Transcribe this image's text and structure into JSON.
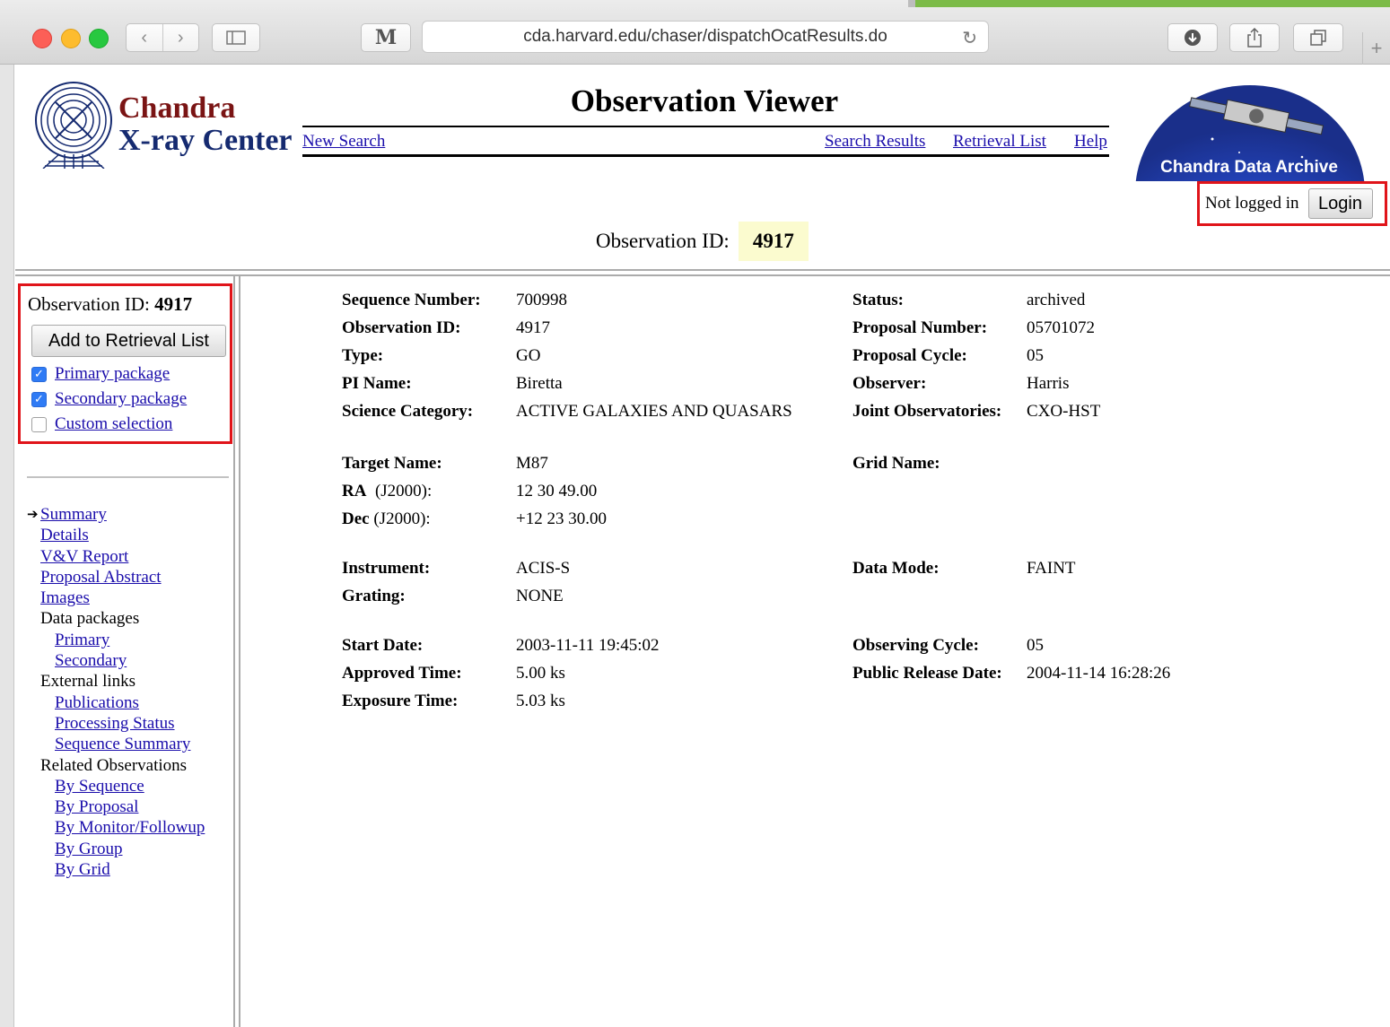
{
  "browser": {
    "url": "cda.harvard.edu/chaser/dispatchOcatResults.do",
    "reader_label": "M"
  },
  "header": {
    "logo_line1": "Chandra",
    "logo_line2": "X-ray Center",
    "title": "Observation Viewer",
    "nav": {
      "new_search": "New Search",
      "search_results": "Search Results",
      "retrieval_list": "Retrieval List",
      "help": "Help"
    },
    "archive_banner": "Chandra Data Archive",
    "login_status": "Not logged in",
    "login_button": "Login",
    "obsid_label": "Observation ID:",
    "obsid_value": "4917"
  },
  "sidebar": {
    "obsid_label": "Observation ID:",
    "obsid_value": "4917",
    "add_button": "Add to Retrieval List",
    "packages": [
      {
        "label": "Primary package",
        "checked": true
      },
      {
        "label": "Secondary package",
        "checked": true
      },
      {
        "label": "Custom selection",
        "checked": false
      }
    ],
    "nav": {
      "summary": "Summary",
      "details": "Details",
      "vv_report": "V&V Report",
      "proposal_abstract": "Proposal Abstract",
      "images": "Images",
      "data_packages": "Data packages",
      "primary": "Primary",
      "secondary": "Secondary",
      "external_links": "External links",
      "publications": "Publications",
      "processing_status": "Processing Status",
      "sequence_summary": "Sequence Summary",
      "related_observations": "Related Observations",
      "by_sequence": "By Sequence",
      "by_proposal": "By Proposal",
      "by_monitor": "By Monitor/Followup",
      "by_group": "By Group",
      "by_grid": "By Grid"
    }
  },
  "details": {
    "sequence_number": {
      "label": "Sequence Number:",
      "value": "700998"
    },
    "observation_id": {
      "label": "Observation ID:",
      "value": "4917"
    },
    "type": {
      "label": "Type:",
      "value": "GO"
    },
    "pi_name": {
      "label": "PI Name:",
      "value": "Biretta"
    },
    "science_category": {
      "label": "Science Category:",
      "value": "ACTIVE GALAXIES AND QUASARS"
    },
    "status": {
      "label": "Status:",
      "value": "archived"
    },
    "proposal_number": {
      "label": "Proposal Number:",
      "value": "05701072"
    },
    "proposal_cycle": {
      "label": "Proposal Cycle:",
      "value": "05"
    },
    "observer": {
      "label": "Observer:",
      "value": "Harris"
    },
    "joint_observatories": {
      "label": "Joint Observatories:",
      "value": "CXO-HST"
    },
    "target_name": {
      "label": "Target Name:",
      "value": "M87"
    },
    "ra": {
      "label_bold": "RA",
      "label_rest": "(J2000):",
      "value": "12 30 49.00"
    },
    "dec": {
      "label_bold": "Dec",
      "label_rest": "(J2000):",
      "value": "+12 23 30.00"
    },
    "grid_name": {
      "label": "Grid Name:",
      "value": ""
    },
    "instrument": {
      "label": "Instrument:",
      "value": "ACIS-S"
    },
    "grating": {
      "label": "Grating:",
      "value": "NONE"
    },
    "data_mode": {
      "label": "Data Mode:",
      "value": "FAINT"
    },
    "start_date": {
      "label": "Start Date:",
      "value": "2003-11-11 19:45:02"
    },
    "approved_time": {
      "label": "Approved Time:",
      "value": "5.00 ks"
    },
    "exposure_time": {
      "label": "Exposure Time:",
      "value": "5.03 ks"
    },
    "observing_cycle": {
      "label": "Observing Cycle:",
      "value": "05"
    },
    "public_release_date": {
      "label": "Public Release Date:",
      "value": "2004-11-14 16:28:26"
    }
  },
  "colors": {
    "highlight_box": "#e0141a",
    "link": "#1a0dab",
    "obsid_bg": "#fbfbcf",
    "logo_red": "#7a1414",
    "logo_blue": "#152a70"
  }
}
